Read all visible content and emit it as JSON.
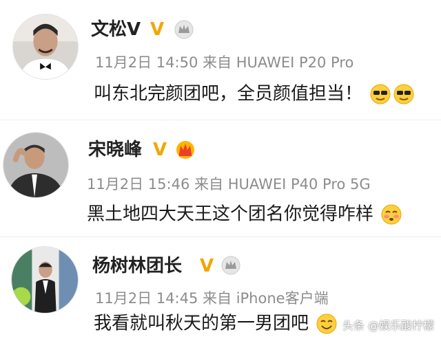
{
  "posts": [
    {
      "username": "文松V",
      "verified_badge": "V",
      "level_icon": "crown-icon",
      "date": "11月2日",
      "time": "14:50",
      "source_prefix": "来自",
      "device": "HUAWEI P20 Pro",
      "content": "叫东北完颜团吧，全员颜值担当！",
      "emojis": [
        "sunglasses-emoji-icon",
        "sunglasses-emoji-icon"
      ]
    },
    {
      "username": "宋晓峰",
      "verified_badge": "V",
      "level_icon": "red-crown-icon",
      "date": "11月2日",
      "time": "15:46",
      "source_prefix": "来自",
      "device": "HUAWEI P40 Pro 5G",
      "content": "黑土地四大天王这个团名你觉得咋样",
      "emojis": [
        "shy-emoji-icon"
      ]
    },
    {
      "username": "杨树林团长",
      "verified_badge": "V",
      "level_icon": "crown-icon",
      "date": "11月2日",
      "time": "14:45",
      "source_prefix": "来自",
      "device": "iPhone客户端",
      "content": "我看就叫秋天的第一男团吧",
      "emojis": [
        "smile-emoji-icon"
      ]
    }
  ],
  "watermark": "头条 @娱乐酸柠檬",
  "colors": {
    "badge": "#f2a600",
    "meta": "#8c8c8c",
    "text": "#1a1a1a"
  }
}
